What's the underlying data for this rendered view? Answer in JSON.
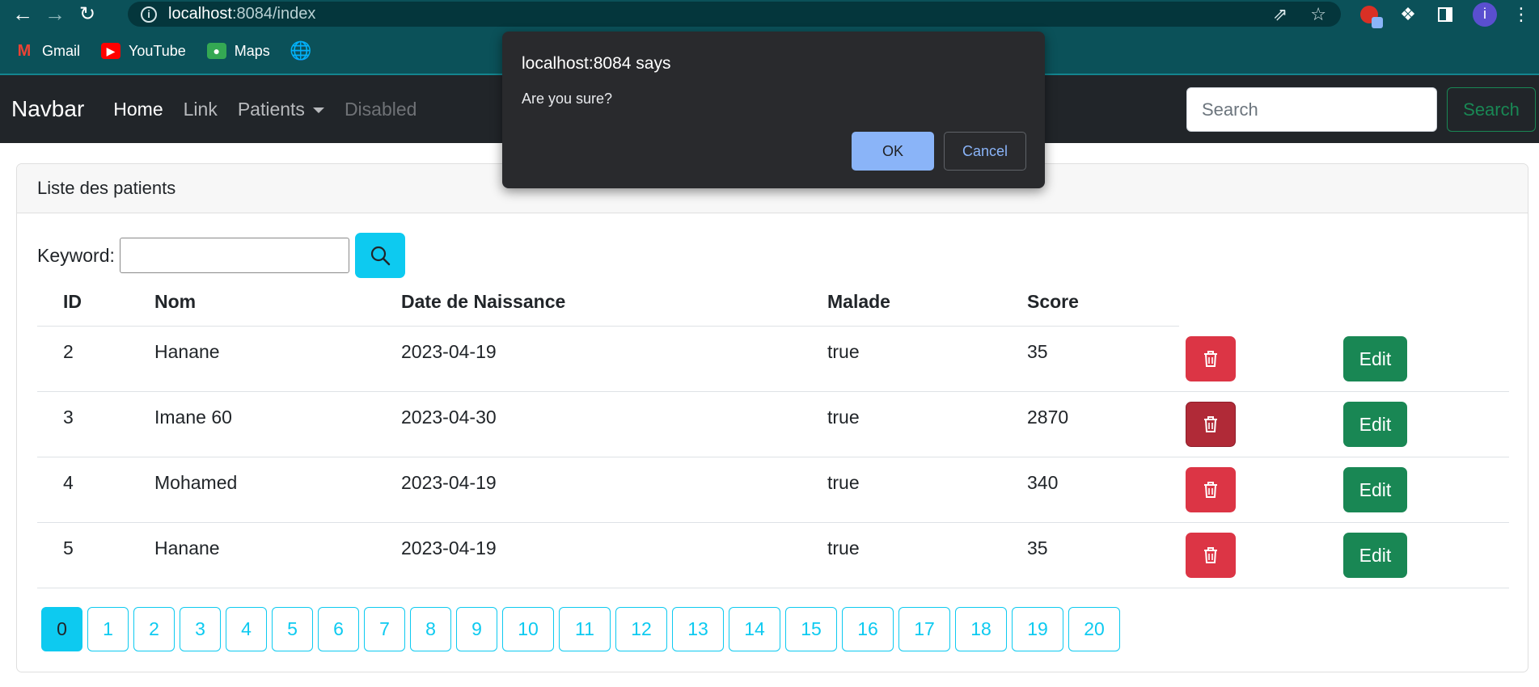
{
  "browser": {
    "url_host": "localhost",
    "url_path": ":8084/index",
    "bookmarks": [
      {
        "label": "Gmail",
        "icon": "gmail-icon"
      },
      {
        "label": "YouTube",
        "icon": "youtube-icon"
      },
      {
        "label": "Maps",
        "icon": "maps-icon"
      }
    ],
    "profile_initial": "i"
  },
  "navbar": {
    "brand": "Navbar",
    "links": [
      "Home",
      "Link",
      "Patients",
      "Disabled"
    ],
    "search_placeholder": "Search",
    "search_button": "Search"
  },
  "card": {
    "header": "Liste des patients",
    "keyword_label": "Keyword:",
    "keyword_value": ""
  },
  "table": {
    "columns": [
      "ID",
      "Nom",
      "Date de Naissance",
      "Malade",
      "Score"
    ],
    "rows": [
      {
        "id": "2",
        "nom": "Hanane",
        "date": "2023-04-19",
        "malade": "true",
        "score": "35"
      },
      {
        "id": "3",
        "nom": "Imane 60",
        "date": "2023-04-30",
        "malade": "true",
        "score": "2870"
      },
      {
        "id": "4",
        "nom": "Mohamed",
        "date": "2023-04-19",
        "malade": "true",
        "score": "340"
      },
      {
        "id": "5",
        "nom": "Hanane",
        "date": "2023-04-19",
        "malade": "true",
        "score": "35"
      }
    ],
    "edit_label": "Edit"
  },
  "pagination": {
    "pages": [
      "0",
      "1",
      "2",
      "3",
      "4",
      "5",
      "6",
      "7",
      "8",
      "9",
      "10",
      "11",
      "12",
      "13",
      "14",
      "15",
      "16",
      "17",
      "18",
      "19",
      "20"
    ],
    "current": "0"
  },
  "dialog": {
    "title": "localhost:8084 says",
    "message": "Are you sure?",
    "ok": "OK",
    "cancel": "Cancel"
  },
  "colors": {
    "chrome": "#0b5159",
    "navbar": "#212529",
    "info": "#0dcaf0",
    "danger": "#dc3545",
    "success": "#198754",
    "dialog": "#292a2d",
    "dialog_accent": "#8ab4f8"
  }
}
